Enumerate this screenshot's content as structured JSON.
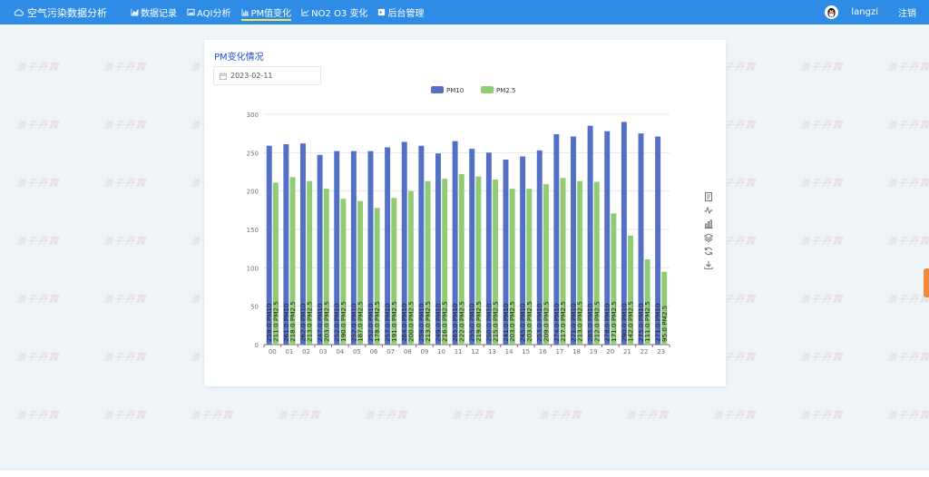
{
  "nav": {
    "brand": "空气污染数据分析",
    "items": [
      {
        "label": "数据记录",
        "icon": "area-chart-icon",
        "active": false
      },
      {
        "label": "AQI分析",
        "icon": "picture-chart-icon",
        "active": false
      },
      {
        "label": "PM值变化",
        "icon": "bar-chart-icon",
        "active": true
      },
      {
        "label": "NO2 O3 变化",
        "icon": "line-chart-icon",
        "active": false
      },
      {
        "label": "后台管理",
        "icon": "admin-icon",
        "active": false
      }
    ],
    "username": "langzi",
    "logout": "注销"
  },
  "watermark_text": "浪子丹霞",
  "card": {
    "title": "PM变化情况",
    "date_value": "2023-02-11"
  },
  "colors": {
    "nav_bg": "#2f8ce6",
    "pm10": "#5470c6",
    "pm25": "#91cc75",
    "title": "#1e4ad6",
    "active_underline": "#f6e84a"
  },
  "chart_data": {
    "type": "bar",
    "categories": [
      "00",
      "01",
      "02",
      "03",
      "04",
      "05",
      "06",
      "07",
      "08",
      "09",
      "10",
      "11",
      "12",
      "13",
      "14",
      "15",
      "16",
      "17",
      "18",
      "19",
      "20",
      "21",
      "22",
      "23"
    ],
    "series": [
      {
        "name": "PM10",
        "values": [
          259,
          261,
          262,
          247,
          252,
          252,
          252,
          257,
          264,
          259,
          249,
          265,
          255,
          250,
          241,
          245,
          253,
          274,
          271,
          285,
          278,
          290,
          275,
          271
        ]
      },
      {
        "name": "PM2.5",
        "values": [
          211,
          218,
          213,
          203,
          190,
          187,
          178,
          191,
          200,
          213,
          216,
          222,
          219,
          215,
          203,
          203,
          209,
          217,
          213,
          212,
          171,
          142,
          111,
          95
        ]
      }
    ],
    "label_formats": [
      "{v}.0  PM10",
      "{v}.0  PM2.5"
    ],
    "ylim": [
      0,
      300
    ],
    "yticks": [
      0,
      50,
      100,
      150,
      200,
      250,
      300
    ],
    "legend": "top-center",
    "grid": true
  }
}
